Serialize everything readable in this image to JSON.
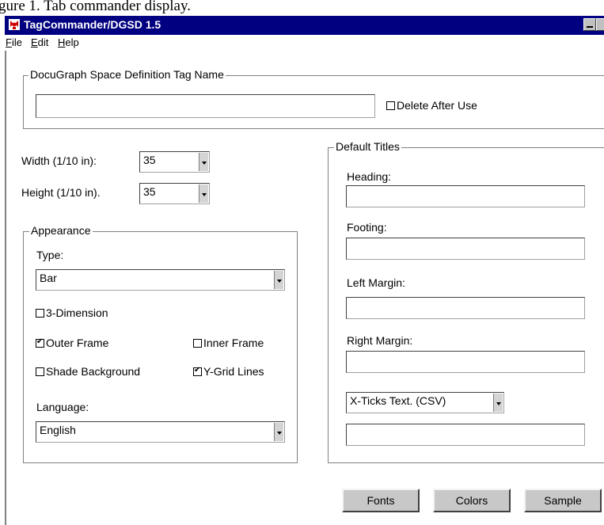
{
  "page_cut_text": "gure 1. Tab commander display.",
  "window": {
    "title": "TagCommander/DGSD 1.5"
  },
  "menu": [
    "File",
    "Edit",
    "Help"
  ],
  "tag_name": {
    "group_title": "DocuGraph Space Definition Tag Name",
    "value": "",
    "delete_after_use_label": "Delete After Use",
    "delete_after_use_checked": false
  },
  "size": {
    "width_label": "Width (1/10 in):",
    "width_value": "35",
    "height_label": "Height (1/10 in).",
    "height_value": "35"
  },
  "appearance": {
    "group_title": "Appearance",
    "type_label": "Type:",
    "type_value": "Bar",
    "three_d_label": "3-Dimension",
    "three_d_checked": false,
    "outer_frame_label": "Outer Frame",
    "outer_frame_checked": true,
    "inner_frame_label": "Inner Frame",
    "inner_frame_checked": false,
    "shade_background_label": "Shade Background",
    "shade_background_checked": false,
    "y_grid_label": "Y-Grid Lines",
    "y_grid_checked": true,
    "language_label": "Language:",
    "language_value": "English"
  },
  "default_titles": {
    "group_title": "Default Titles",
    "heading_label": "Heading:",
    "heading_value": "",
    "footing_label": "Footing:",
    "footing_value": "",
    "left_margin_label": "Left Margin:",
    "left_margin_value": "",
    "right_margin_label": "Right Margin:",
    "right_margin_value": "",
    "x_ticks_select": "X-Ticks Text. (CSV)",
    "x_ticks_value": ""
  },
  "buttons": {
    "fonts": "Fonts",
    "colors": "Colors",
    "sample": "Sample"
  }
}
